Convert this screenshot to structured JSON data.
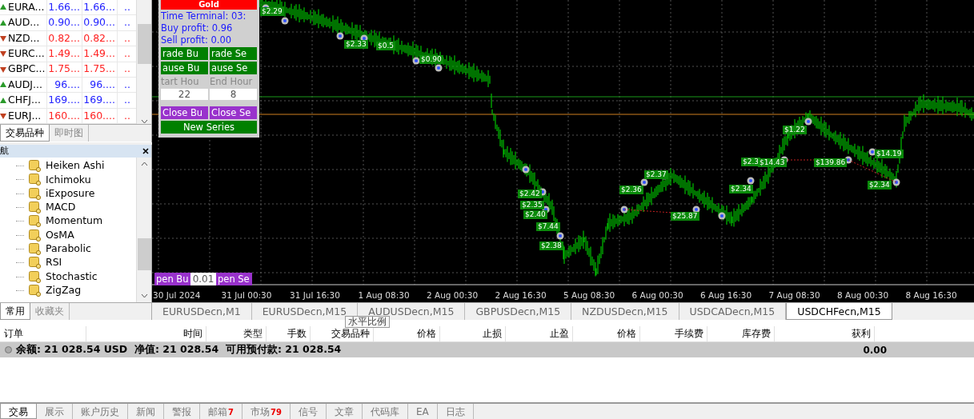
{
  "market_watch": {
    "rows": [
      {
        "symbol": "EURA...",
        "bid": "1.66...",
        "ask": "1.66...",
        "column_4": "..",
        "up": true,
        "color": "#2222ff"
      },
      {
        "symbol": "AUD...",
        "bid": "0.90...",
        "ask": "0.90...",
        "column_4": "..",
        "up": true,
        "color": "#2222ff"
      },
      {
        "symbol": "NZD...",
        "bid": "0.82...",
        "ask": "0.82...",
        "column_4": "..",
        "up": false,
        "color": "#ff2222"
      },
      {
        "symbol": "EURC...",
        "bid": "1.49...",
        "ask": "1.49...",
        "column_4": "..",
        "up": false,
        "color": "#ff2222"
      },
      {
        "symbol": "GBPC...",
        "bid": "1.75...",
        "ask": "1.75...",
        "column_4": "..",
        "up": false,
        "color": "#ff2222"
      },
      {
        "symbol": "AUDJ...",
        "bid": "96....",
        "ask": "96....",
        "column_4": "..",
        "up": true,
        "color": "#2222ff"
      },
      {
        "symbol": "CHFJ...",
        "bid": "169....",
        "ask": "169....",
        "column_4": "..",
        "up": true,
        "color": "#2222ff"
      },
      {
        "symbol": "EURJ...",
        "bid": "160....",
        "ask": "160....",
        "column_4": "..",
        "up": false,
        "color": "#ff2222"
      }
    ],
    "tabs": [
      {
        "label": "交易品种",
        "selected": true
      },
      {
        "label": "即时图",
        "selected": false
      }
    ]
  },
  "navigator": {
    "title": "航",
    "items": [
      "Heiken Ashi",
      "Ichimoku",
      "iExposure",
      "MACD",
      "Momentum",
      "OsMA",
      "Parabolic",
      "RSI",
      "Stochastic",
      "ZigZag"
    ],
    "tabs": [
      {
        "label": "常用",
        "selected": true
      },
      {
        "label": "收藏夹",
        "selected": false
      }
    ]
  },
  "chart": {
    "panel": {
      "title": "Gold",
      "lines": [
        "Time Terminal: 03:",
        "Buy profit: 0.96",
        "Sell profit: 0.00"
      ],
      "button_rows": [
        [
          "rade Bu",
          "rade Se"
        ],
        [
          "ause Bu",
          "ause Se"
        ]
      ],
      "hour_labels": [
        "tart Hou",
        "End Hour"
      ],
      "hour_values": [
        "22",
        "8"
      ],
      "close_buttons": [
        "Close Bu",
        "Close Se"
      ],
      "new_series": "New Series"
    },
    "order_bar": {
      "buy": "pen Bu",
      "lots": "0.01",
      "sell": "pen Se"
    },
    "trade_labels": [
      "$2.29",
      "$2.33",
      "$0.5",
      "$0.90",
      "$2.42",
      "$2.35",
      "$2.40",
      "$7.44",
      "$2.38",
      "$2.36",
      "$2.37",
      "$25.87",
      "$2.34",
      "$2.3",
      "$14.43",
      "$1.22",
      "$139.86",
      "$14.19",
      "$2.34"
    ],
    "x_axis_labels": [
      "30 Jul 2024",
      "31 Jul 00:30",
      "31 Jul 16:30",
      "1 Aug 08:30",
      "2 Aug 00:30",
      "2 Aug 16:30",
      "5 Aug 08:30",
      "6 Aug 00:30",
      "6 Aug 16:30",
      "7 Aug 08:30",
      "8 Aug 00:30",
      "8 Aug 16:30"
    ]
  },
  "chart_tabs": [
    {
      "label": "EURUSDecn,M1",
      "selected": false
    },
    {
      "label": "EURUSDecn,M15",
      "selected": false
    },
    {
      "label": "AUDUSDecn,M15",
      "selected": false
    },
    {
      "label": "GBPUSDecn,M15",
      "selected": false
    },
    {
      "label": "NZDUSDecn,M15",
      "selected": false
    },
    {
      "label": "USDCADecn,M15",
      "selected": false
    },
    {
      "label": "USDCHFecn,M15",
      "selected": true
    }
  ],
  "terminal": {
    "tooltip": "水平比例",
    "columns": [
      "订单",
      "时间",
      "类型",
      "手数",
      "交易品种",
      "价格",
      "止损",
      "止盈",
      "价格",
      "手续费",
      "库存费",
      "获利"
    ],
    "summary": {
      "text": "余额: 21 028.54 USD  净值: 21 028.54  可用预付款: 21 028.54",
      "profit": "0.00"
    },
    "tabs": [
      {
        "label": "交易",
        "selected": true
      },
      {
        "label": "展示",
        "selected": false
      },
      {
        "label": "账户历史",
        "selected": false
      },
      {
        "label": "新闻",
        "selected": false
      },
      {
        "label": "警报",
        "selected": false
      },
      {
        "label": "邮箱",
        "badge": "7",
        "selected": false
      },
      {
        "label": "市场",
        "badge": "79",
        "selected": false
      },
      {
        "label": "信号",
        "selected": false
      },
      {
        "label": "文章",
        "selected": false
      },
      {
        "label": "代码库",
        "selected": false
      },
      {
        "label": "EA",
        "selected": false
      },
      {
        "label": "日志",
        "selected": false
      }
    ]
  }
}
